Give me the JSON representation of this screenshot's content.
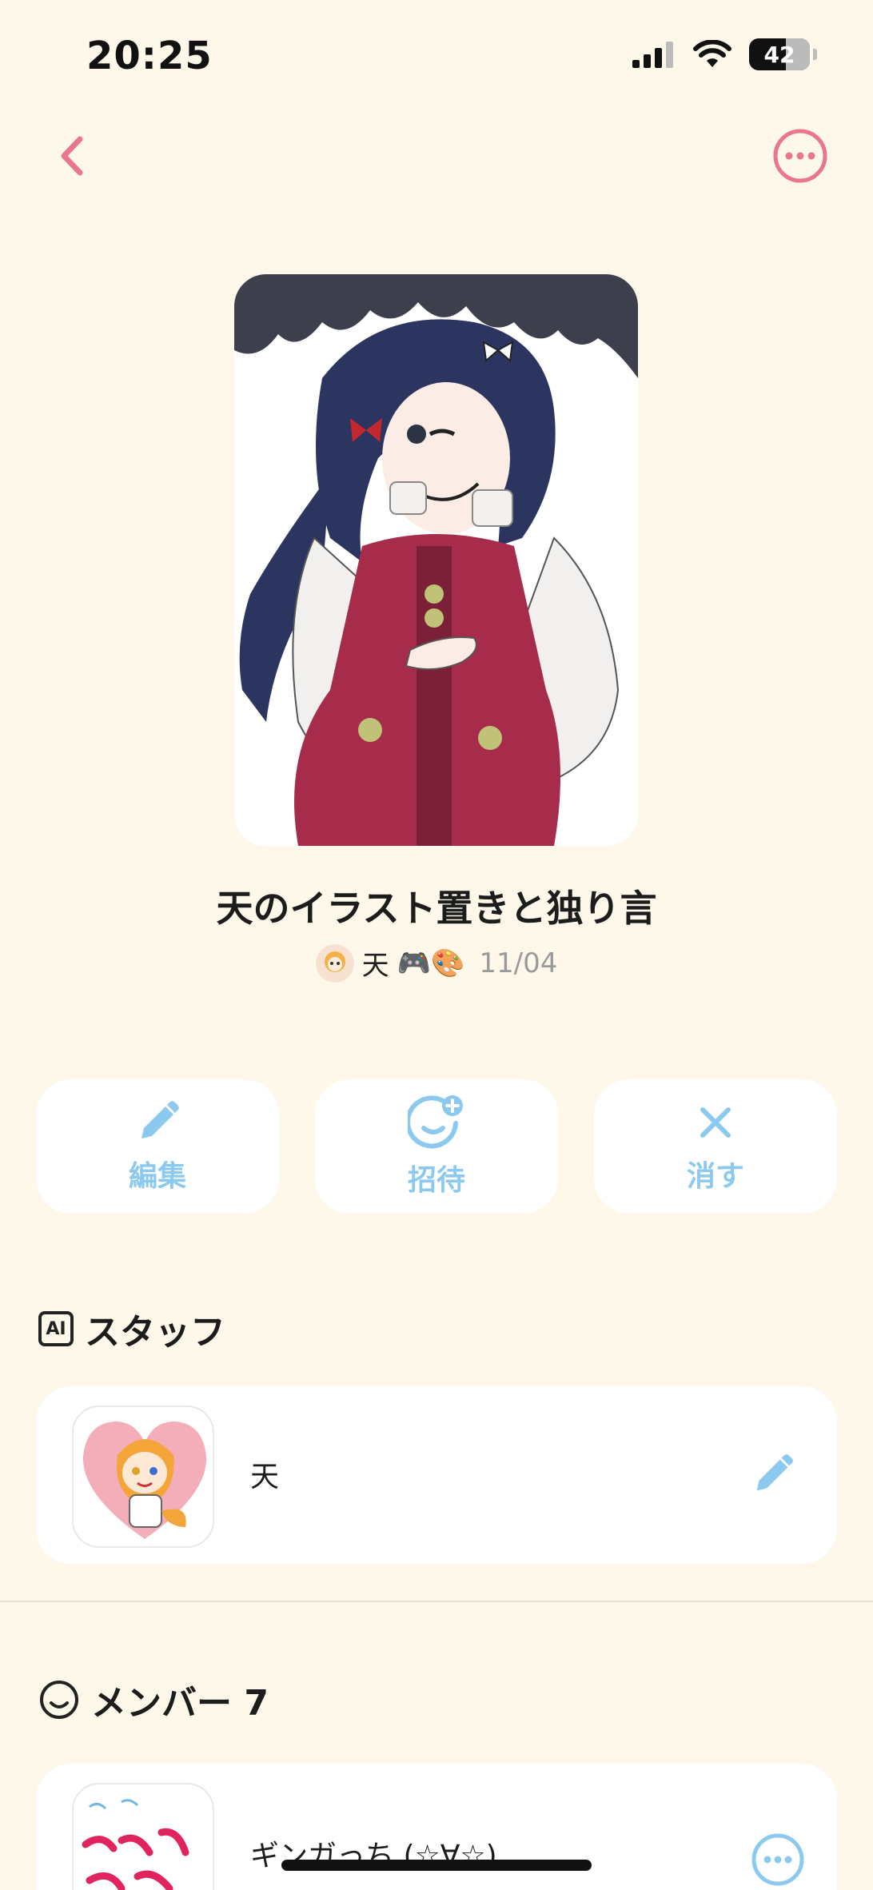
{
  "status_bar": {
    "time": "20:25",
    "battery": "42"
  },
  "nav": {
    "back_icon": "chevron-left-icon",
    "more_icon": "ellipsis-circle-icon"
  },
  "room": {
    "title": "天のイラスト置きと独り言",
    "owner_name": "天",
    "owner_emoji": "🎮🎨",
    "date": "11/04"
  },
  "actions": [
    {
      "label": "編集",
      "icon": "pencil-icon"
    },
    {
      "label": "招待",
      "icon": "invite-face-plus-icon"
    },
    {
      "label": "消す",
      "icon": "close-icon"
    }
  ],
  "staff": {
    "badge": "AI",
    "heading": "スタッフ",
    "member": {
      "name": "天"
    }
  },
  "members": {
    "heading": "メンバー 7",
    "first": {
      "name": "ギンガっち (☆∀☆)"
    }
  },
  "colors": {
    "background": "#fdf8ea",
    "accent_pink": "#e9768f",
    "accent_blue": "#8cc9ee"
  }
}
